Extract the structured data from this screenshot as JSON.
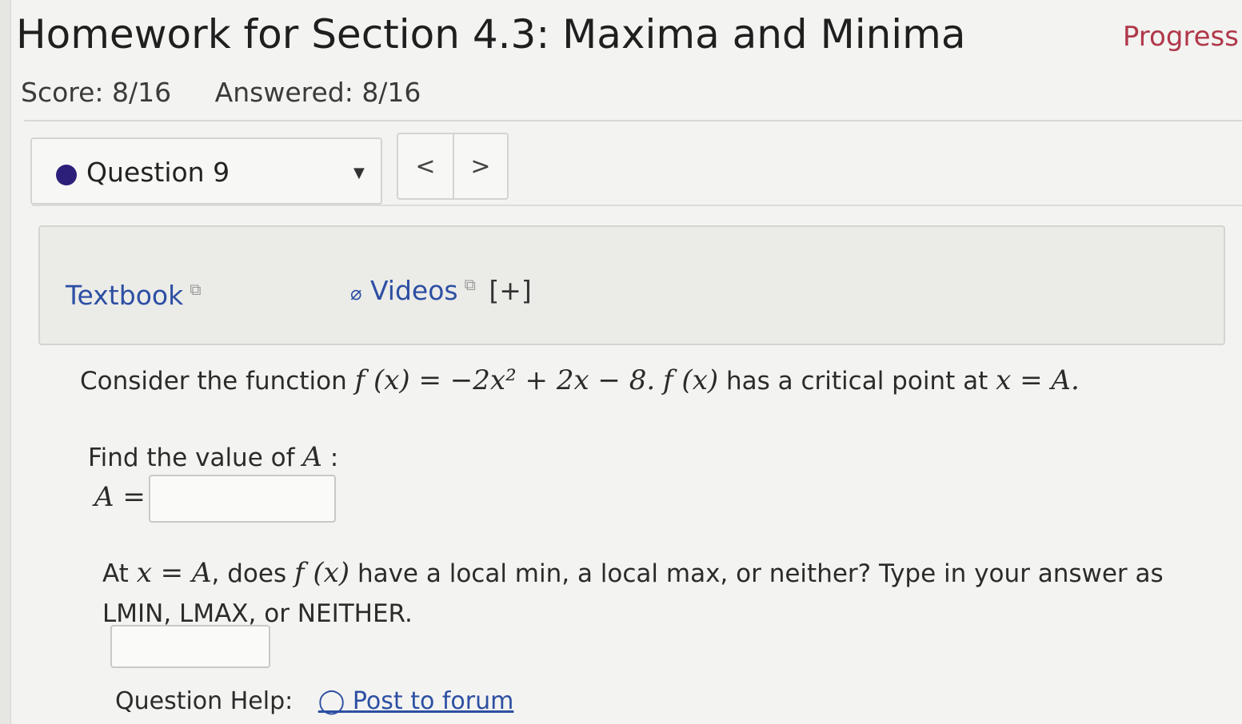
{
  "header": {
    "title": "Homework for Section 4.3: Maxima and Minima",
    "progress_label": "Progress",
    "score": "Score: 8/16",
    "answered": "Answered: 8/16"
  },
  "question_nav": {
    "selected": "Question 9",
    "prev": "<",
    "next": ">"
  },
  "resources": {
    "textbook": "Textbook",
    "videos": "Videos",
    "expand": "[+]"
  },
  "problem": {
    "intro": "Consider the function",
    "function": "f (x) = −2x² + 2x − 8.",
    "critical_point": "f (x)",
    "critical_text": "has a critical point at",
    "critical_eq": "x = A.",
    "find_prompt": "Find the value of",
    "find_var": "A",
    "find_colon": ":",
    "answer_label": "A =",
    "answer1_value": "",
    "q2_prefix": "At",
    "q2_eq": "x = A",
    "q2_mid": ", does",
    "q2_fx": "f (x)",
    "q2_rest": "have a local min, a local max, or neither? Type in your answer as LMIN, LMAX, or NEITHER.",
    "answer2_value": ""
  },
  "help": {
    "label": "Question Help:",
    "forum_link": "Post to forum"
  },
  "colors": {
    "progress": "#b0384a",
    "link": "#2d4fa3",
    "dot": "#2b1f7a"
  }
}
